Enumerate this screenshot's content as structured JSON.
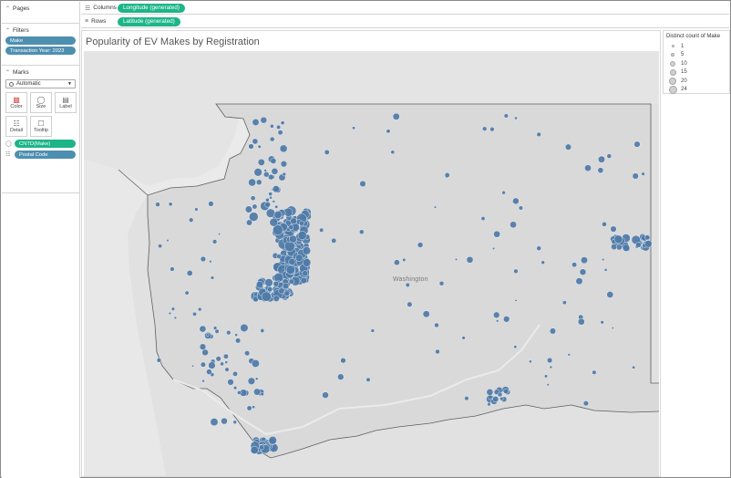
{
  "pages_card": {
    "title": "Pages"
  },
  "filters_card": {
    "title": "Filters",
    "filters": [
      "Make",
      "Transaction Year: 2023"
    ]
  },
  "marks_card": {
    "title": "Marks",
    "mark_type": "Automatic",
    "buttons": [
      {
        "label": "Color",
        "icon": "color-icon"
      },
      {
        "label": "Size",
        "icon": "size-icon"
      },
      {
        "label": "Label",
        "icon": "label-icon"
      },
      {
        "label": "Detail",
        "icon": "detail-icon"
      },
      {
        "label": "Tooltip",
        "icon": "tooltip-icon"
      }
    ],
    "fields": [
      {
        "label": "CNTD(Make)",
        "color": "#1db588",
        "icon": "size-encoding-icon"
      },
      {
        "label": "Postal Code",
        "color": "#4d8fb0",
        "icon": "detail-encoding-icon"
      }
    ]
  },
  "shelves": {
    "columns_label": "Columns",
    "columns_pill": "Longitude (generated)",
    "rows_label": "Rows",
    "rows_pill": "Latitude (generated)"
  },
  "view": {
    "title": "Popularity of EV Makes by Registration",
    "map_label": "Washington"
  },
  "legend": {
    "title": "Distinct count of Make",
    "values": [
      "1",
      "5",
      "10",
      "15",
      "20",
      "24"
    ]
  },
  "colors": {
    "mark": "#4e79a7",
    "pill_dimension": "#4d8fb0",
    "pill_measure": "#1db588",
    "map_background": "#dedede"
  }
}
